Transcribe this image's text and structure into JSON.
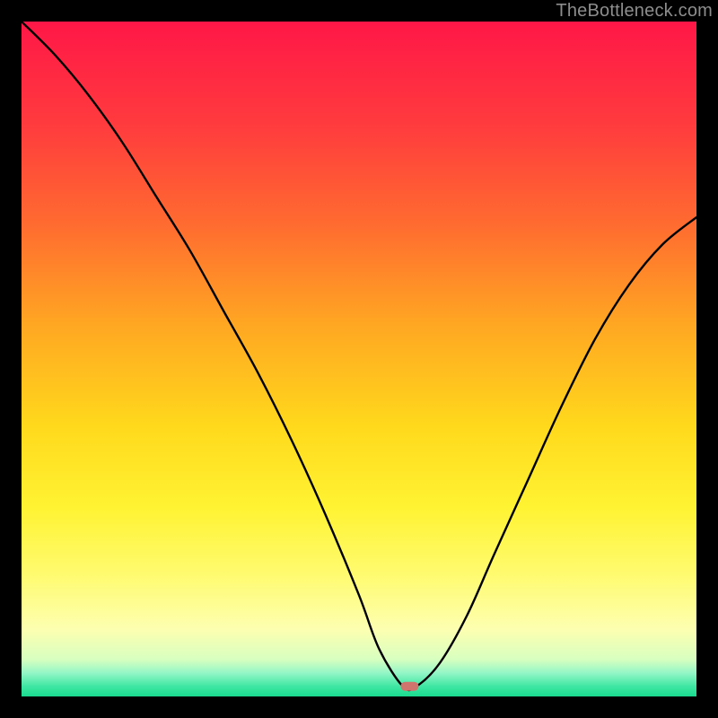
{
  "watermark": "TheBottleneck.com",
  "chart_data": {
    "type": "line",
    "title": "",
    "xlabel": "",
    "ylabel": "",
    "xlim": [
      0,
      100
    ],
    "ylim": [
      0,
      100
    ],
    "grid": false,
    "legend": false,
    "annotations": [],
    "background": {
      "type": "vertical-gradient",
      "stops": [
        {
          "pos": 0.0,
          "color": "#ff1747"
        },
        {
          "pos": 0.15,
          "color": "#ff3a3e"
        },
        {
          "pos": 0.3,
          "color": "#ff6b30"
        },
        {
          "pos": 0.45,
          "color": "#ffa722"
        },
        {
          "pos": 0.6,
          "color": "#ffd91c"
        },
        {
          "pos": 0.72,
          "color": "#fff332"
        },
        {
          "pos": 0.82,
          "color": "#fffb70"
        },
        {
          "pos": 0.9,
          "color": "#fdffb0"
        },
        {
          "pos": 0.945,
          "color": "#d8ffc0"
        },
        {
          "pos": 0.965,
          "color": "#94f6c6"
        },
        {
          "pos": 0.985,
          "color": "#3fe7a3"
        },
        {
          "pos": 1.0,
          "color": "#18db8f"
        }
      ]
    },
    "series": [
      {
        "name": "bottleneck-curve",
        "color": "#000000",
        "x": [
          0,
          5,
          10,
          15,
          20,
          25,
          30,
          35,
          40,
          45,
          50,
          53,
          56.5,
          58.5,
          62,
          66,
          70,
          75,
          80,
          85,
          90,
          95,
          100
        ],
        "values": [
          100,
          95,
          89,
          82,
          74,
          66,
          57,
          48,
          38,
          27,
          15,
          7,
          1.5,
          1.5,
          5,
          12,
          21,
          32,
          43,
          53,
          61,
          67,
          71
        ]
      }
    ],
    "marker": {
      "name": "min-marker",
      "x": 57.5,
      "y": 1.5,
      "color": "#d2746e",
      "shape": "pill"
    }
  }
}
